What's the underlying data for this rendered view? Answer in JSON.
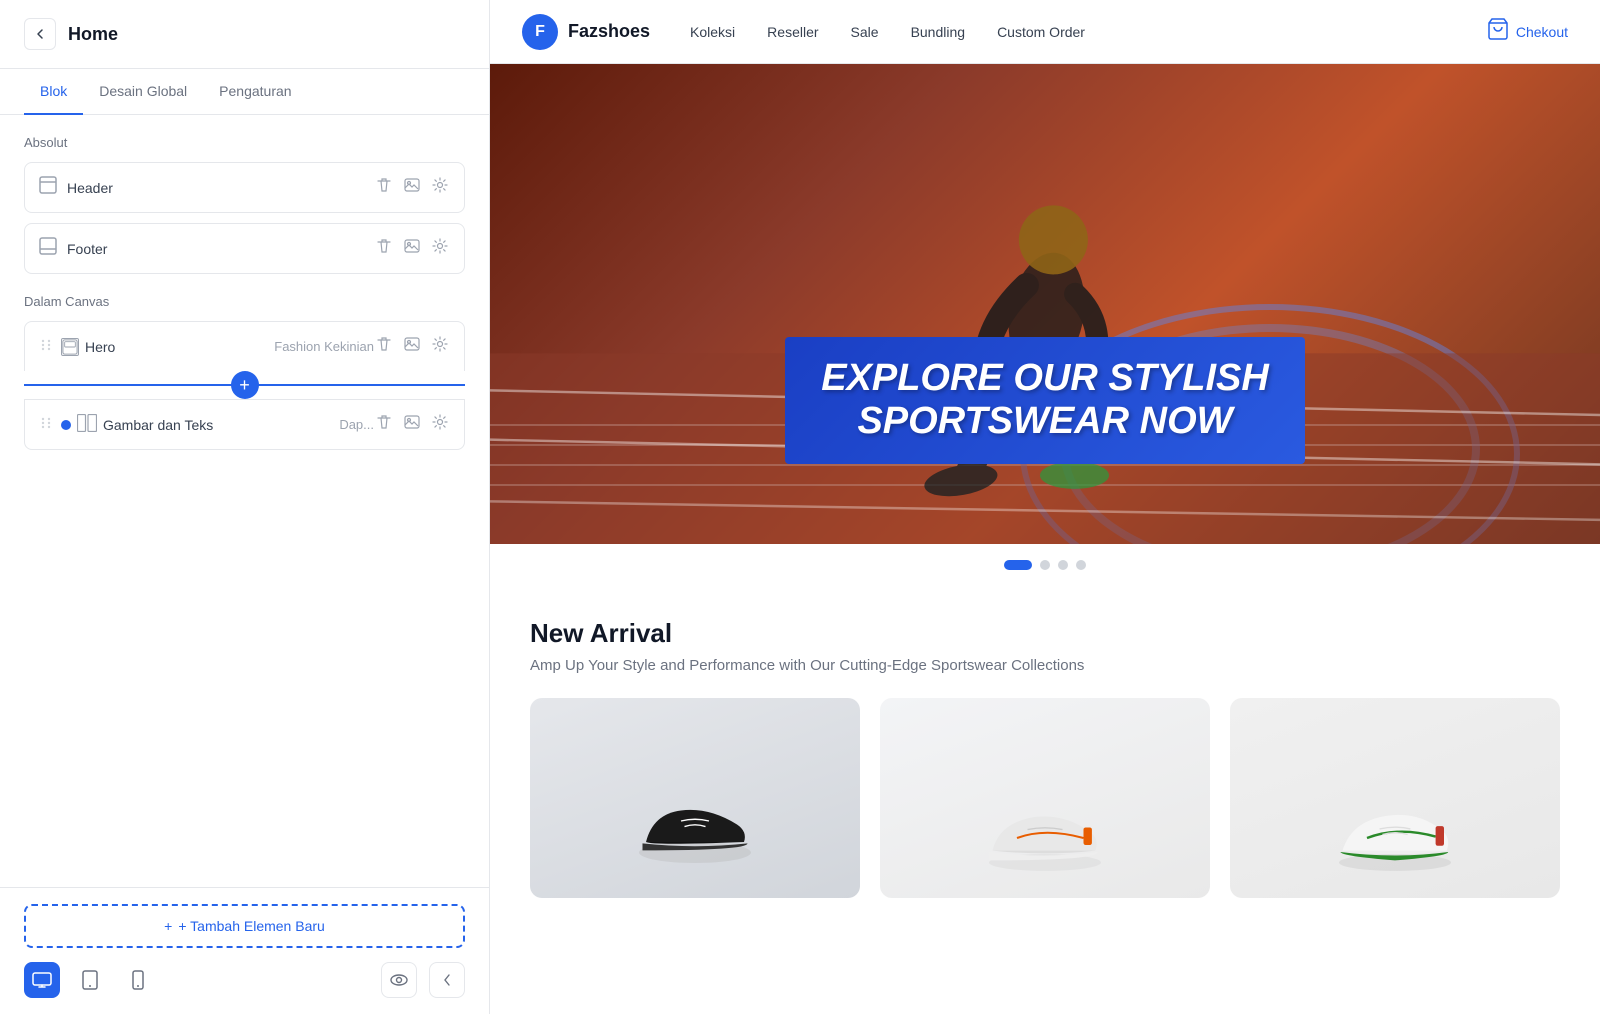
{
  "panel": {
    "title": "Home",
    "back_label": "←",
    "tabs": [
      {
        "label": "Blok",
        "active": true
      },
      {
        "label": "Desain Global",
        "active": false
      },
      {
        "label": "Pengaturan",
        "active": false
      }
    ],
    "absolut_label": "Absolut",
    "blocks": [
      {
        "name": "Header"
      },
      {
        "name": "Footer"
      }
    ],
    "dalam_canvas_label": "Dalam Canvas",
    "canvas_items": [
      {
        "name": "Hero",
        "subtitle": "Fashion Kekinian"
      },
      {
        "name": "Gambar dan Teks",
        "subtitle": "Dap..."
      }
    ],
    "add_element_label": "+ Tambah Elemen Baru"
  },
  "navbar": {
    "brand_letter": "F",
    "brand_name": "Fazshoes",
    "links": [
      "Koleksi",
      "Reseller",
      "Sale",
      "Bundling",
      "Custom Order"
    ],
    "checkout_label": "Chekout"
  },
  "hero": {
    "title_line1": "EXPLORE OUR STYLISH",
    "title_line2": "SPORTSWEAR NOW"
  },
  "new_arrival": {
    "title": "New Arrival",
    "description": "Amp Up Your Style and Performance with Our Cutting-Edge Sportswear Collections"
  },
  "icons": {
    "drag": "⋮⋮",
    "block_frame": "⊡",
    "delete": "🗑",
    "image": "🖼",
    "settings": "⚙",
    "plus": "+",
    "desktop": "🖥",
    "tablet": "⬜",
    "mobile": "📱",
    "eye": "👁",
    "chevron_left": "‹",
    "cart": "🛒"
  }
}
